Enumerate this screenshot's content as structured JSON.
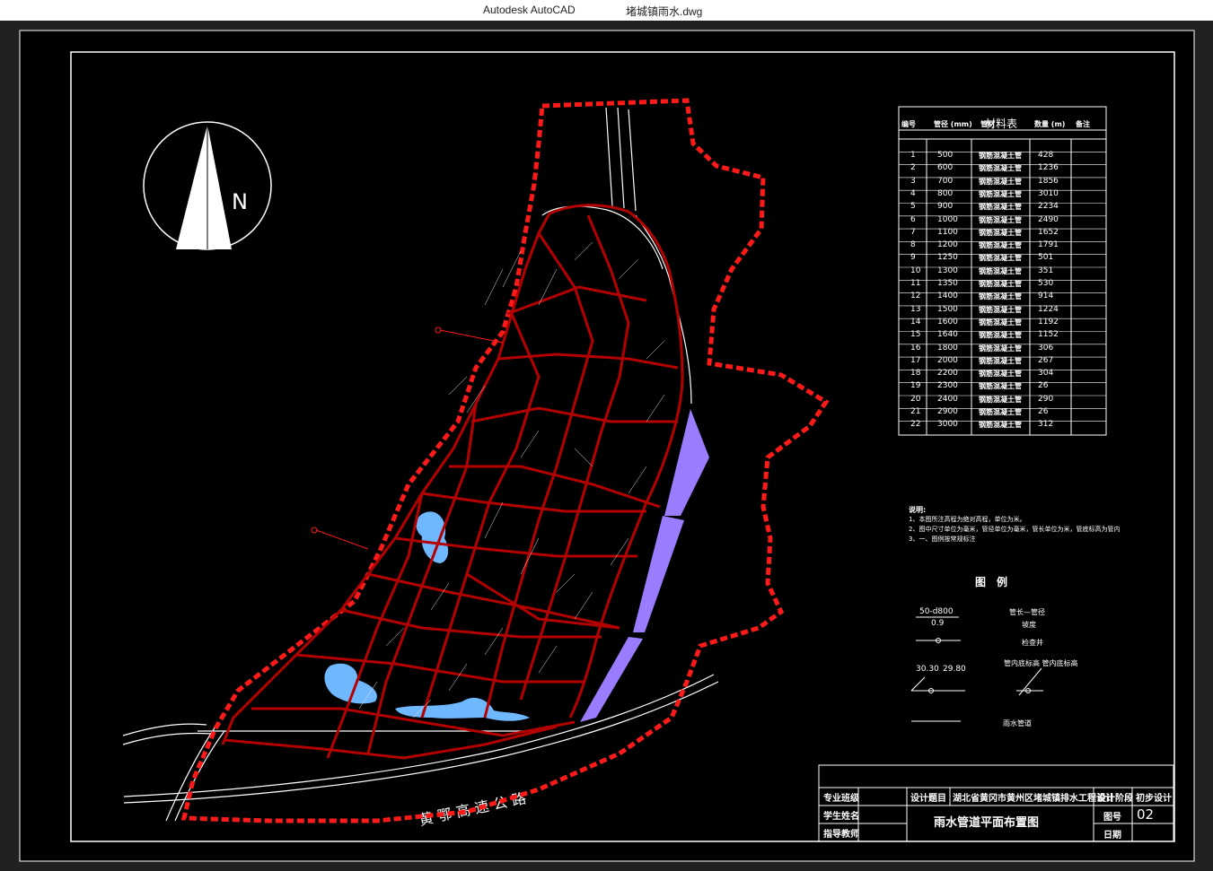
{
  "window": {
    "app_name": "Autodesk AutoCAD",
    "file_name": "堵城镇雨水.dwg"
  },
  "north": {
    "label": "N"
  },
  "highway": {
    "label": "黄 鄂 高 速 公 路"
  },
  "material_table": {
    "title": "材料表",
    "headers": [
      "编号",
      "管径 (mm)",
      "管材",
      "数量 (m)",
      "备注"
    ],
    "rows": [
      [
        "1",
        "500",
        "钢筋混凝土管",
        "428"
      ],
      [
        "2",
        "600",
        "钢筋混凝土管",
        "1236"
      ],
      [
        "3",
        "700",
        "钢筋混凝土管",
        "1856"
      ],
      [
        "4",
        "800",
        "钢筋混凝土管",
        "3010"
      ],
      [
        "5",
        "900",
        "钢筋混凝土管",
        "2234"
      ],
      [
        "6",
        "1000",
        "钢筋混凝土管",
        "2490"
      ],
      [
        "7",
        "1100",
        "钢筋混凝土管",
        "1652"
      ],
      [
        "8",
        "1200",
        "钢筋混凝土管",
        "1791"
      ],
      [
        "9",
        "1250",
        "钢筋混凝土管",
        "501"
      ],
      [
        "10",
        "1300",
        "钢筋混凝土管",
        "351"
      ],
      [
        "11",
        "1350",
        "钢筋混凝土管",
        "530"
      ],
      [
        "12",
        "1400",
        "钢筋混凝土管",
        "914"
      ],
      [
        "13",
        "1500",
        "钢筋混凝土管",
        "1224"
      ],
      [
        "14",
        "1600",
        "钢筋混凝土管",
        "1192"
      ],
      [
        "15",
        "1640",
        "钢筋混凝土管",
        "1152"
      ],
      [
        "16",
        "1800",
        "钢筋混凝土管",
        "306"
      ],
      [
        "17",
        "2000",
        "钢筋混凝土管",
        "267"
      ],
      [
        "18",
        "2200",
        "钢筋混凝土管",
        "304"
      ],
      [
        "19",
        "2300",
        "钢筋混凝土管",
        "26"
      ],
      [
        "20",
        "2400",
        "钢筋混凝土管",
        "290"
      ],
      [
        "21",
        "2900",
        "钢筋混凝土管",
        "26"
      ],
      [
        "22",
        "3000",
        "钢筋混凝土管",
        "312"
      ]
    ]
  },
  "notes": {
    "title": "说明:",
    "lines": [
      "1、本图所注高程为绝对高程，单位为米。",
      "2、图中尺寸单位为毫米，管径单位为毫米，管长单位为米，管底标高为管内",
      "3、一、图例按常规标注"
    ]
  },
  "legend": {
    "title": "图　例",
    "pipe_label": "50-d800",
    "slope_label": "0.9",
    "pipe_desc": "管长—管径",
    "slope_desc": "坡度",
    "manhole_desc": "检查井",
    "elev_left": "30.30",
    "elev_right": "29.80",
    "elev_desc": "管内底标高  管内底标高",
    "rain_pipe_desc": "雨水管道"
  },
  "title_block": {
    "major_label": "专业班级",
    "student_label": "学生姓名",
    "advisor_label": "指导教师",
    "design_topic_label": "设计题目",
    "design_topic": "湖北省黄冈市黄州区堵城镇排水工程设计",
    "drawing_title": "雨水管道平面布置图",
    "stage_label": "设计阶段",
    "stage_value": "初步设计",
    "drawing_no_label": "图号",
    "drawing_no": "02",
    "date_label": "日期"
  },
  "colors": {
    "boundary": "#ff1a1a",
    "pipe": "#b30000",
    "water": "#6fb7ff",
    "purple_zone": "#9a7cff"
  }
}
